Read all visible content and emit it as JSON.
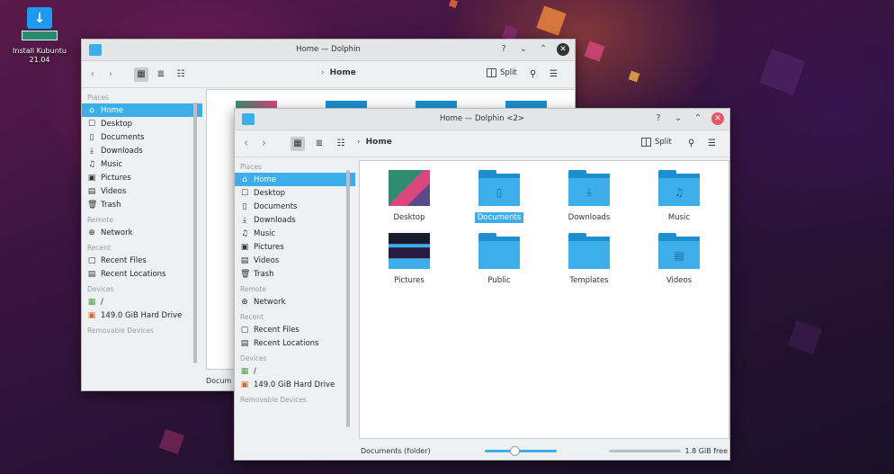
{
  "desktop_icon": {
    "label": "Install Kubuntu 21.04"
  },
  "back_window": {
    "title": "Home — Dolphin",
    "help": "?",
    "breadcrumb": "Home",
    "split_label": "Split",
    "places_header": "Places",
    "places": [
      {
        "icon": "home-icon",
        "glyph": "⌂",
        "label": "Home",
        "selected": true
      },
      {
        "icon": "desktop-icon",
        "glyph": "☐",
        "label": "Desktop"
      },
      {
        "icon": "documents-icon",
        "glyph": "▯",
        "label": "Documents"
      },
      {
        "icon": "downloads-icon",
        "glyph": "⤓",
        "label": "Downloads"
      },
      {
        "icon": "music-icon",
        "glyph": "♫",
        "label": "Music"
      },
      {
        "icon": "pictures-icon",
        "glyph": "▣",
        "label": "Pictures"
      },
      {
        "icon": "videos-icon",
        "glyph": "▤",
        "label": "Videos"
      },
      {
        "icon": "trash-icon",
        "glyph": "🗑",
        "label": "Trash"
      }
    ],
    "remote_header": "Remote",
    "network": "Network",
    "recent_header": "Recent",
    "recent_files": "Recent Files",
    "recent_locations": "Recent Locations",
    "devices_header": "Devices",
    "root_device": "/",
    "hard_drive": "149.0 GiB Hard Drive",
    "removable_header": "Removable Devices",
    "status_partial": "Docum"
  },
  "front_window": {
    "title": "Home — Dolphin <2>",
    "help": "?",
    "breadcrumb": "Home",
    "split_label": "Split",
    "places_header": "Places",
    "places": [
      {
        "icon": "home-icon",
        "glyph": "⌂",
        "label": "Home",
        "selected": true
      },
      {
        "icon": "desktop-icon",
        "glyph": "☐",
        "label": "Desktop"
      },
      {
        "icon": "documents-icon",
        "glyph": "▯",
        "label": "Documents"
      },
      {
        "icon": "downloads-icon",
        "glyph": "⤓",
        "label": "Downloads"
      },
      {
        "icon": "music-icon",
        "glyph": "♫",
        "label": "Music"
      },
      {
        "icon": "pictures-icon",
        "glyph": "▣",
        "label": "Pictures"
      },
      {
        "icon": "videos-icon",
        "glyph": "▤",
        "label": "Videos"
      },
      {
        "icon": "trash-icon",
        "glyph": "🗑",
        "label": "Trash"
      }
    ],
    "remote_header": "Remote",
    "network": "Network",
    "recent_header": "Recent",
    "recent_files": "Recent Files",
    "recent_locations": "Recent Locations",
    "devices_header": "Devices",
    "root_device": "/",
    "hard_drive": "149.0 GiB Hard Drive",
    "removable_header": "Removable Devices",
    "files": [
      {
        "label": "Desktop",
        "kind": "desktop-thumbnail"
      },
      {
        "label": "Documents",
        "kind": "folder",
        "emblem": "▯",
        "selected": true
      },
      {
        "label": "Downloads",
        "kind": "folder",
        "emblem": "⤓"
      },
      {
        "label": "Music",
        "kind": "folder",
        "emblem": "♫"
      },
      {
        "label": "Pictures",
        "kind": "pictures-thumbnail"
      },
      {
        "label": "Public",
        "kind": "folder",
        "emblem": ""
      },
      {
        "label": "Templates",
        "kind": "folder",
        "emblem": ""
      },
      {
        "label": "Videos",
        "kind": "folder",
        "emblem": "▤"
      }
    ],
    "status_text": "Documents (folder)",
    "free_space": "1.8 GiB free"
  },
  "colors": {
    "accent": "#3daee9",
    "folder": "#3daee9",
    "close_active": "#e95464"
  }
}
